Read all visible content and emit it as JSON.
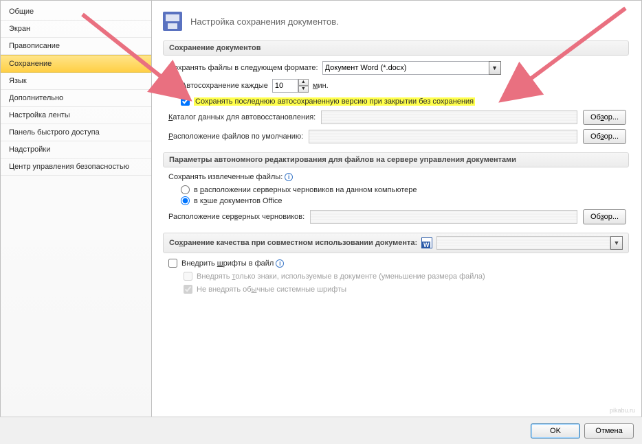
{
  "sidebar": {
    "items": [
      {
        "label": "Общие"
      },
      {
        "label": "Экран"
      },
      {
        "label": "Правописание"
      },
      {
        "label": "Сохранение",
        "selected": true
      },
      {
        "label": "Язык"
      },
      {
        "label": "Дополнительно"
      },
      {
        "label": "Настройка ленты"
      },
      {
        "label": "Панель быстрого доступа"
      },
      {
        "label": "Надстройки"
      },
      {
        "label": "Центр управления безопасностью"
      }
    ]
  },
  "header": {
    "title": "Настройка сохранения документов."
  },
  "group_save": {
    "title": "Сохранение документов",
    "format_label_pre": "Сохранять файлы в сле",
    "format_label_u": "д",
    "format_label_post": "ующем формате:",
    "format_value": "Документ Word (*.docx)",
    "autosave_u": "А",
    "autosave_label": "втосохранение каждые",
    "autosave_value": "10",
    "autosave_unit_u": "м",
    "autosave_unit": "ин.",
    "keep_last_label": "Сохранять последнюю автосохраненную версию при закрытии без сохранения",
    "recovery_u": "К",
    "recovery_label": "аталог данных для автовосстановления:",
    "default_loc_u": "Р",
    "default_loc_label": "асположение файлов по умолчанию:",
    "browse": "Обзор..."
  },
  "browse": "Об",
  "browse_u": "з",
  "browse_post": "ор...",
  "group_offline": {
    "title": "Параметры автономного редактирования для файлов на сервере управления документами",
    "save_extracted_label": "Сохранять извлеченные файлы:",
    "radio1_pre": "в ",
    "radio1_u": "р",
    "radio1_post": "асположении серверных черновиков на данном компьютере",
    "radio2_pre": "в к",
    "radio2_u": "э",
    "radio2_post": "ше документов Office",
    "drafts_loc_pre": "Расположение сер",
    "drafts_loc_u": "в",
    "drafts_loc_post": "ерных черновиков:"
  },
  "group_quality": {
    "title_pre": "Со",
    "title_u": "х",
    "title_post": "ранение качества при совместном использовании документа:",
    "embed_pre": "Внедрить ",
    "embed_u": "ш",
    "embed_post": "рифты в файл",
    "opt1_pre": "Внедрять ",
    "opt1_u": "т",
    "opt1_post": "олько знаки, используемые в документе (уменьшение размера файла)",
    "opt2_pre": "Не внедрять об",
    "opt2_u": "ы",
    "opt2_post": "чные системные шрифты"
  },
  "footer": {
    "ok": "OK",
    "cancel": "Отмена"
  },
  "watermark": "pikabu.ru"
}
